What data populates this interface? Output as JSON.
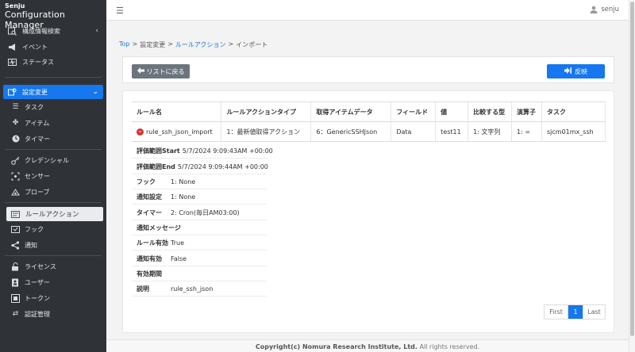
{
  "app": {
    "brand_line1": "Senju",
    "brand_line2": "Configuration Manager"
  },
  "topbar": {
    "menu_icon": "hamburger-icon",
    "user_name": "senju"
  },
  "sidebar": {
    "items": [
      {
        "label": "構成情報検索",
        "icon": "search-box-icon"
      },
      {
        "label": "イベント",
        "icon": "megaphone-icon"
      },
      {
        "label": "ステータス",
        "icon": "pulse-icon"
      },
      {
        "label": "設定変更",
        "icon": "settings-icon"
      },
      {
        "label": "タスク",
        "icon": "task-list-icon"
      },
      {
        "label": "アイテム",
        "icon": "puzzle-icon"
      },
      {
        "label": "タイマー",
        "icon": "clock-icon"
      },
      {
        "label": "クレデンシャル",
        "icon": "key-icon"
      },
      {
        "label": "センサー",
        "icon": "sensor-icon"
      },
      {
        "label": "プローブ",
        "icon": "probe-icon"
      },
      {
        "label": "ルールアクション",
        "icon": "rule-icon"
      },
      {
        "label": "フック",
        "icon": "hook-icon"
      },
      {
        "label": "通知",
        "icon": "share-icon"
      },
      {
        "label": "ライセンス",
        "icon": "unlock-icon"
      },
      {
        "label": "ユーザー",
        "icon": "user-book-icon"
      },
      {
        "label": "トークン",
        "icon": "token-icon"
      },
      {
        "label": "認証管理",
        "icon": "exchange-icon"
      }
    ]
  },
  "breadcrumb": {
    "top": "Top",
    "sep": ">",
    "settings": "設定変更",
    "rule_action": "ルールアクション",
    "import": "インポート"
  },
  "actions": {
    "back_label": "リストに戻る",
    "apply_label": "反映"
  },
  "table": {
    "headers": [
      "ルール名",
      "ルールアクションタイプ",
      "取得アイテムデータ",
      "フィールド",
      "値",
      "比較する型",
      "演算子",
      "タスク"
    ],
    "rows": [
      [
        "rule_ssh_json_import",
        "1：最新値取得アクション",
        "6：GenericSSHJson",
        "Data",
        "test11",
        "1: 文字列",
        "1: =",
        "sjcm01mx_ssh"
      ]
    ]
  },
  "details": {
    "eval_start_key": "評価範囲Start",
    "eval_start_value": "5/7/2024 9:09:43AM +00:00",
    "eval_end_key": "評価範囲End",
    "eval_end_value": "5/7/2024 9:09:44AM +00:00",
    "hook_key": "フック",
    "hook_value": "1: None",
    "notify_setting_key": "通知設定",
    "notify_setting_value": "1: None",
    "timer_key": "タイマー",
    "timer_value": "2: Cron(毎日AM03:00)",
    "notify_message_key": "通知メッセージ",
    "notify_message_value": "",
    "rule_enabled_key": "ルール有効",
    "rule_enabled_value": "True",
    "notify_enabled_key": "通知有効",
    "notify_enabled_value": "False",
    "validity_key": "有効期間",
    "validity_value": "",
    "description_key": "説明",
    "description_value": "rule_ssh_json"
  },
  "pager": {
    "first": "First",
    "current": "1",
    "last": "Last"
  },
  "footer": {
    "owner": "Copyright(c) Nomura Research Institute, Ltd.",
    "rights": "All rights reserved."
  },
  "colors": {
    "sidebar_bg": "#2f3338",
    "accent": "#1677ee",
    "back_button": "#6c757d",
    "remove": "#d63232"
  }
}
